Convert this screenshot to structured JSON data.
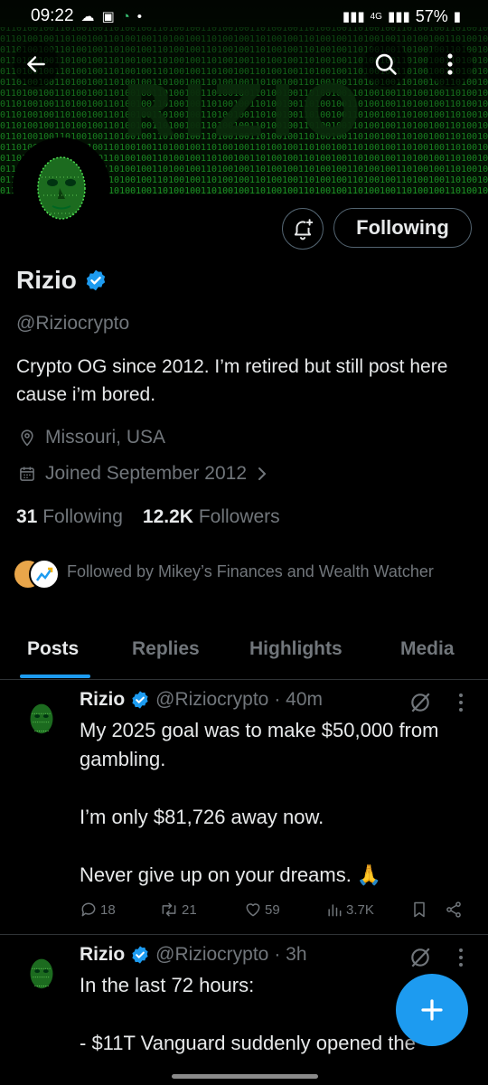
{
  "status_bar": {
    "time": "09:22",
    "network": "4G",
    "battery": "57%"
  },
  "banner": {
    "text": "RIZIO"
  },
  "profile": {
    "name": "Rizio",
    "handle": "@Riziocrypto",
    "bio": "Crypto OG since 2012. I’m retired but still post here cause i’m bored.",
    "location": "Missouri, USA",
    "joined": "Joined September 2012",
    "follow_button": "Following",
    "following_count": "31",
    "following_label": "Following",
    "followers_count": "12.2K",
    "followers_label": "Followers",
    "followed_by": "Followed by Mikey’s Finances and Wealth Watcher"
  },
  "tabs": [
    {
      "label": "Posts"
    },
    {
      "label": "Replies"
    },
    {
      "label": "Highlights"
    },
    {
      "label": "Media"
    }
  ],
  "posts": [
    {
      "name": "Rizio",
      "handle": "@Riziocrypto",
      "time": "· 40m",
      "lines": [
        "My 2025 goal was to make $50,000 from gambling.",
        "I’m only $81,726 away now.",
        "Never give up on your dreams. 🙏"
      ],
      "replies": "18",
      "reposts": "21",
      "likes": "59",
      "views": "3.7K"
    },
    {
      "name": "Rizio",
      "handle": "@Riziocrypto",
      "time": "· 3h",
      "lines": [
        "In the last 72 hours:",
        "- $11T Vanguard suddenly opened the"
      ]
    }
  ],
  "colors": {
    "accent": "#1d9bf0",
    "muted": "#71767b",
    "divider": "#2f3336",
    "matrix_green": "#22c22e"
  }
}
